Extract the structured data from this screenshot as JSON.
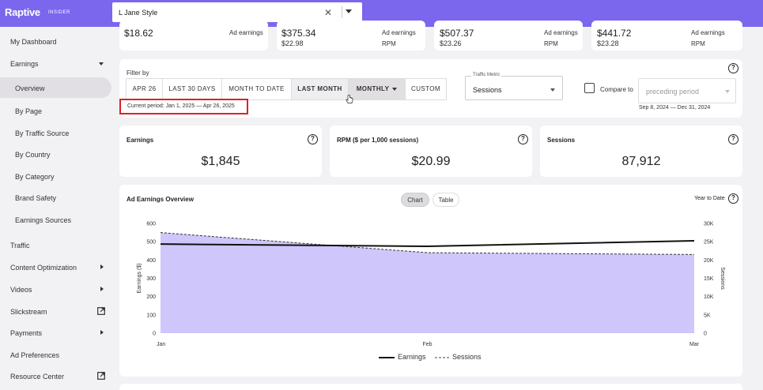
{
  "header": {
    "logo": "Raptive",
    "logo_sub": "INSIDER",
    "site_value": "L Jane Style"
  },
  "sidebar": {
    "items": [
      {
        "label": "My Dashboard"
      },
      {
        "label": "Earnings"
      },
      {
        "label": "Overview"
      },
      {
        "label": "By Page"
      },
      {
        "label": "By Traffic Source"
      },
      {
        "label": "By Country"
      },
      {
        "label": "By Category"
      },
      {
        "label": "Brand Safety"
      },
      {
        "label": "Earnings Sources"
      },
      {
        "label": "Traffic"
      },
      {
        "label": "Content Optimization"
      },
      {
        "label": "Videos"
      },
      {
        "label": "Slickstream"
      },
      {
        "label": "Payments"
      },
      {
        "label": "Ad Preferences"
      },
      {
        "label": "Resource Center"
      }
    ]
  },
  "top_stats": [
    {
      "value": "$18.62",
      "sub": "",
      "label1": "Ad earnings",
      "label2": ""
    },
    {
      "value": "$375.34",
      "sub": "$22.98",
      "label1": "Ad earnings",
      "label2": "RPM"
    },
    {
      "value": "$507.37",
      "sub": "$23.26",
      "label1": "Ad earnings",
      "label2": "RPM"
    },
    {
      "value": "$441.72",
      "sub": "$23.28",
      "label1": "Ad earnings",
      "label2": "RPM"
    }
  ],
  "filter": {
    "title": "Filter by",
    "segments": [
      "APR 26",
      "LAST 30 DAYS",
      "MONTH TO DATE",
      "LAST MONTH",
      "MONTHLY",
      "CUSTOM"
    ],
    "current_period": "Current period: Jan 1, 2025 — Apr 26, 2025",
    "traffic_metric_label": "Traffic Metric",
    "traffic_metric_value": "Sessions",
    "compare_label": "Compare to",
    "compare_value": "preceding period",
    "compare_range": "Sep 8, 2024 — Dec 31, 2024"
  },
  "kpis": [
    {
      "title": "Earnings",
      "value": "$1,845"
    },
    {
      "title": "RPM ($ per 1,000 sessions)",
      "value": "$20.99"
    },
    {
      "title": "Sessions",
      "value": "87,912"
    }
  ],
  "chart_card": {
    "title": "Ad Earnings Overview",
    "toggle_chart": "Chart",
    "toggle_table": "Table",
    "period_label": "Year to Date"
  },
  "chart_data": {
    "type": "line",
    "categories": [
      "Jan",
      "Feb",
      "Mar"
    ],
    "series": [
      {
        "name": "Earnings",
        "axis": "left",
        "style": "solid",
        "values": [
          487,
          475,
          505
        ]
      },
      {
        "name": "Sessions",
        "axis": "right",
        "style": "dashed",
        "values": [
          27500,
          22000,
          21500
        ]
      }
    ],
    "ylabel": "Earnings ($)",
    "y2label": "Sessions",
    "ylim": [
      0,
      600
    ],
    "y2lim": [
      0,
      30000
    ],
    "yticks": [
      "0",
      "100",
      "200",
      "300",
      "400",
      "500",
      "600"
    ],
    "y2ticks": [
      "0",
      "5K",
      "10K",
      "15K",
      "20K",
      "25K",
      "30K"
    ],
    "legend": "bottom-center",
    "area_color": "#cfc6fb",
    "line_color": "#111111",
    "accent": "#7b66ee"
  }
}
